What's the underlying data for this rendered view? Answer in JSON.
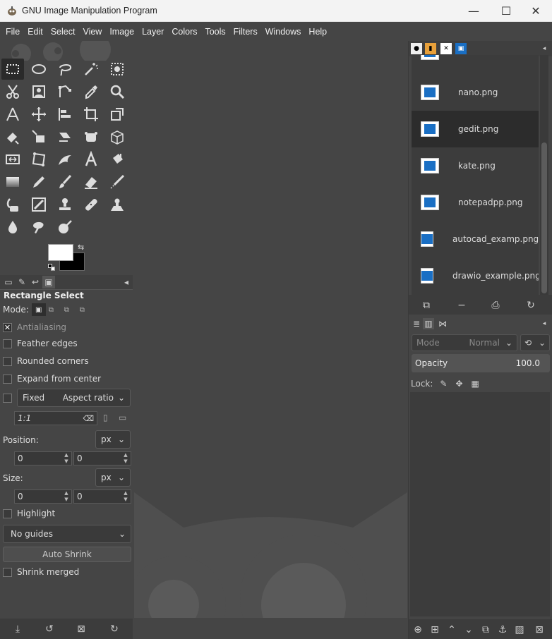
{
  "window": {
    "title": "GNU Image Manipulation Program",
    "controls": {
      "minimize": "—",
      "maximize": "☐",
      "close": "✕"
    }
  },
  "menubar": [
    "File",
    "Edit",
    "Select",
    "View",
    "Image",
    "Layer",
    "Colors",
    "Tools",
    "Filters",
    "Windows",
    "Help"
  ],
  "toolbox": {
    "tools": [
      "rect-select",
      "ellipse-select",
      "free-select",
      "fuzzy-select",
      "by-color-select",
      "scissors-select",
      "foreground-select",
      "paths",
      "color-picker",
      "zoom",
      "measure",
      "move",
      "align",
      "crop",
      "unified-transform",
      "warp-transform",
      "handle-transform",
      "shear",
      "cage-transform",
      "perspective",
      "flip",
      "3d-transform",
      "text-gradient",
      "text",
      "bucket-fill",
      "gradient",
      "pencil",
      "paintbrush",
      "eraser",
      "airbrush",
      "ink",
      "mypaint-brush",
      "clone",
      "heal",
      "perspective-clone",
      "blur",
      "smudge",
      "dodge-burn"
    ]
  },
  "tool_options": {
    "title": "Rectangle Select",
    "mode_label": "Mode:",
    "antialiasing": "Antialiasing",
    "feather_edges": "Feather edges",
    "rounded_corners": "Rounded corners",
    "expand_from_center": "Expand from center",
    "fixed": "Fixed",
    "fixed_mode": "Aspect ratio",
    "ratio_value": "1:1",
    "position_label": "Position:",
    "position_unit": "px",
    "position_x": "0",
    "position_y": "0",
    "size_label": "Size:",
    "size_unit": "px",
    "size_w": "0",
    "size_h": "0",
    "highlight": "Highlight",
    "guides": "No guides",
    "auto_shrink": "Auto Shrink",
    "shrink_merged": "Shrink merged"
  },
  "images_dock": {
    "items": [
      {
        "name": "nano.png"
      },
      {
        "name": "gedit.png"
      },
      {
        "name": "kate.png"
      },
      {
        "name": "notepadpp.png"
      },
      {
        "name": "autocad_examp.png"
      },
      {
        "name": "drawio_example.png"
      }
    ],
    "selected": "gedit.png"
  },
  "layers_dock": {
    "mode_label": "Mode",
    "mode_value": "Normal",
    "opacity_label": "Opacity",
    "opacity_value": "100.0",
    "lock_label": "Lock:"
  }
}
